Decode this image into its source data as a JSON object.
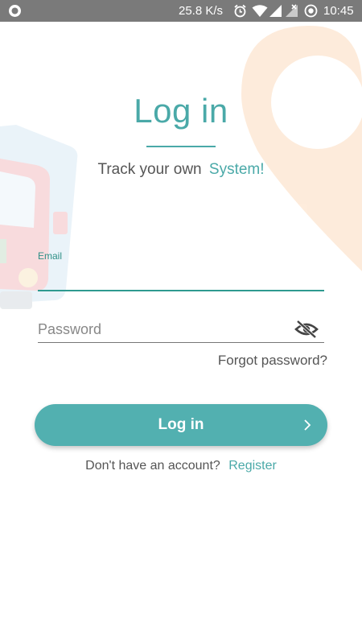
{
  "status_bar": {
    "speed": "25.8 K/s",
    "time": "10:45",
    "icons": [
      "record-icon",
      "alarm-icon",
      "wifi-icon",
      "signal-icon",
      "no-signal-icon",
      "sync-icon"
    ]
  },
  "login": {
    "title": "Log in",
    "tagline_prefix": "Track your own",
    "tagline_accent": "System!",
    "email_label": "Email",
    "email_value": "",
    "password_placeholder": "Password",
    "forgot_password": "Forgot password?",
    "login_button": "Log in",
    "register_prompt": "Don't have an account?",
    "register_link": "Register"
  },
  "colors": {
    "accent": "#4aa9a8",
    "button": "#52b0b0",
    "status_bar": "#7a7a7a"
  }
}
